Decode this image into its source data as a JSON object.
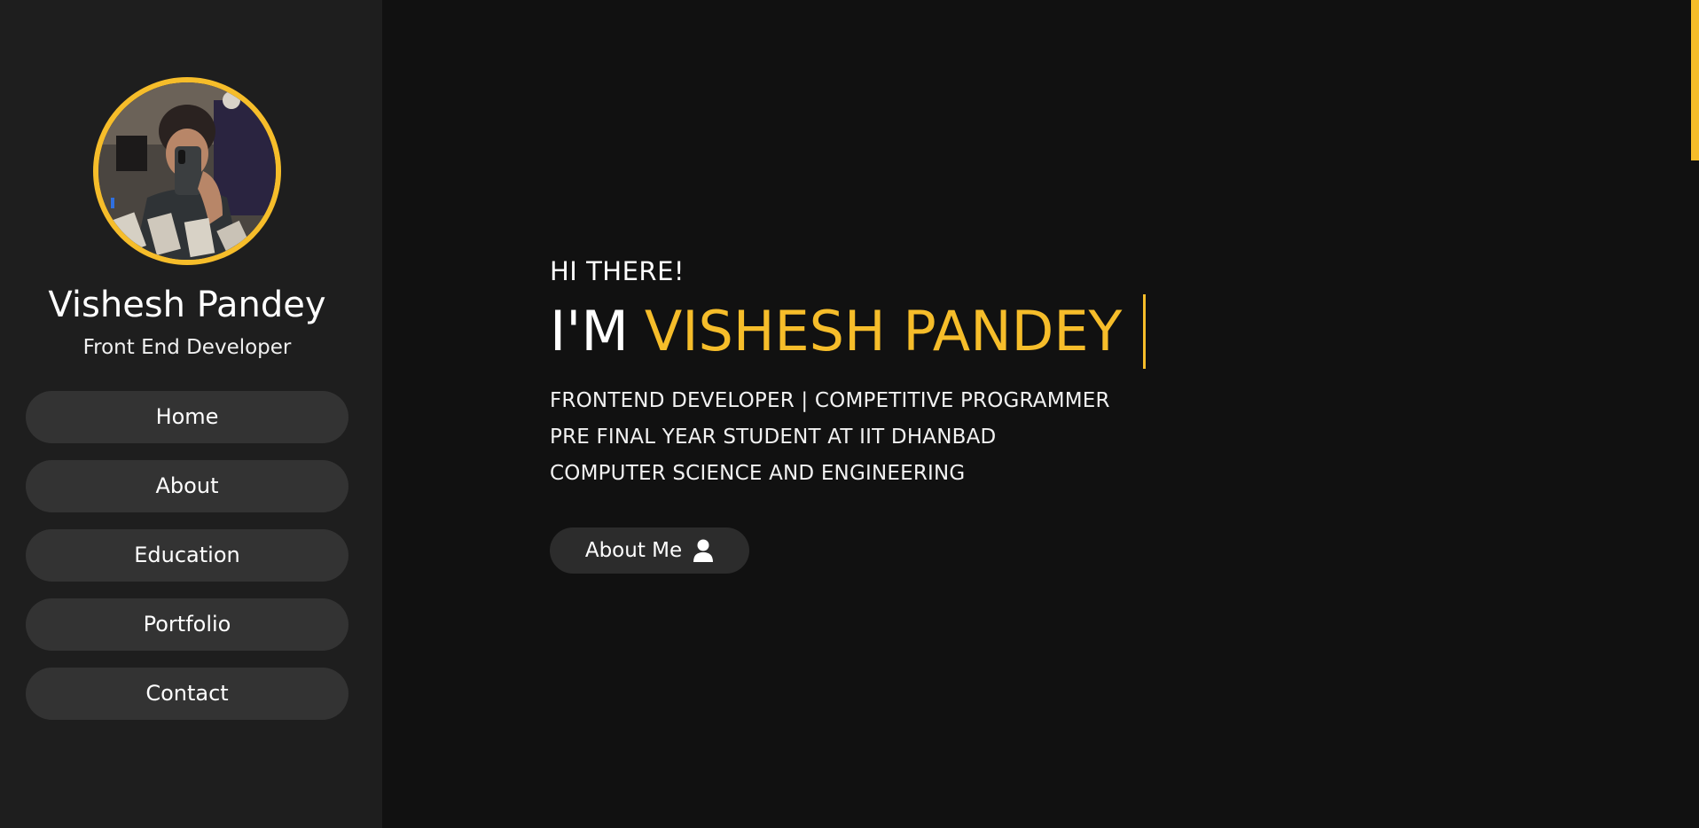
{
  "colors": {
    "accent": "#f6bd2a",
    "background": "#111111",
    "sidebar": "#1e1e1e",
    "button": "#333333"
  },
  "sidebar": {
    "name": "Vishesh Pandey",
    "role": "Front End Developer",
    "nav": [
      {
        "label": "Home"
      },
      {
        "label": "About"
      },
      {
        "label": "Education"
      },
      {
        "label": "Portfolio"
      },
      {
        "label": "Contact"
      }
    ]
  },
  "hero": {
    "greeting": "HI THERE!",
    "prefix": "I'M",
    "name": "VISHESH PANDEY",
    "lines": [
      "FRONTEND DEVELOPER | COMPETITIVE PROGRAMMER",
      "PRE FINAL YEAR STUDENT AT IIT DHANBAD",
      "COMPUTER SCIENCE AND ENGINEERING"
    ],
    "button_label": "About Me",
    "button_icon": "user-icon"
  }
}
